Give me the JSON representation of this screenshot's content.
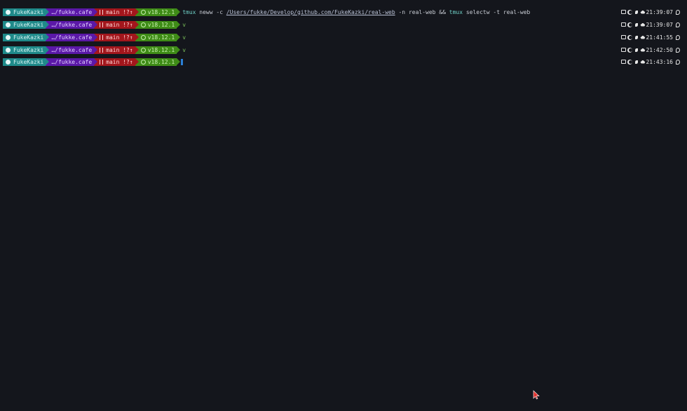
{
  "terminal": {
    "lines": [
      {
        "user": "FukeKazki",
        "dir": "…/fukke.cafe",
        "branch": "main !?↑",
        "node": "v18.12.1",
        "command": {
          "kw1": "tmux",
          "arg1": " neww -c ",
          "path": "/Users/fukke/Develop/github.com/FukeKazki/real-web",
          "arg2": " -n real-web ",
          "op": "&&",
          "kw2": " tmux",
          "arg3": " selectw -t real-web"
        },
        "time": "21:39:07"
      },
      {
        "user": "FukeKazki",
        "dir": "…/fukke.cafe",
        "branch": "main !?↑",
        "node": "v18.12.1",
        "prompt": "v",
        "time": "21:39:07"
      },
      {
        "user": "FukeKazki",
        "dir": "…/fukke.cafe",
        "branch": "main !?↑",
        "node": "v18.12.1",
        "prompt": "v",
        "time": "21:41:55"
      },
      {
        "user": "FukeKazki",
        "dir": "…/fukke.cafe",
        "branch": "main !?↑",
        "node": "v18.12.1",
        "prompt": "v",
        "time": "21:42:50"
      },
      {
        "user": "FukeKazki",
        "dir": "…/fukke.cafe",
        "branch": "main !?↑",
        "node": "v18.12.1",
        "cursor": true,
        "time": "21:43:16"
      }
    ],
    "icons": {
      "user": "github-icon",
      "branch": "git-branch-icon",
      "node": "nodejs-icon",
      "battery": "battery-icon",
      "moon": "moon-icon",
      "leaf": "leaf-icon",
      "ship": "spaceship-icon",
      "clock": "clock-icon",
      "pointer": "mouse-pointer-icon"
    },
    "colors": {
      "background": "#14161c",
      "user_segment": "#1f8a8a",
      "dir_segment": "#5b18a8",
      "git_segment": "#a3161c",
      "node_segment": "#3f8c17",
      "cursor": "#2a7fd4",
      "pointer": "#e0332f"
    }
  }
}
